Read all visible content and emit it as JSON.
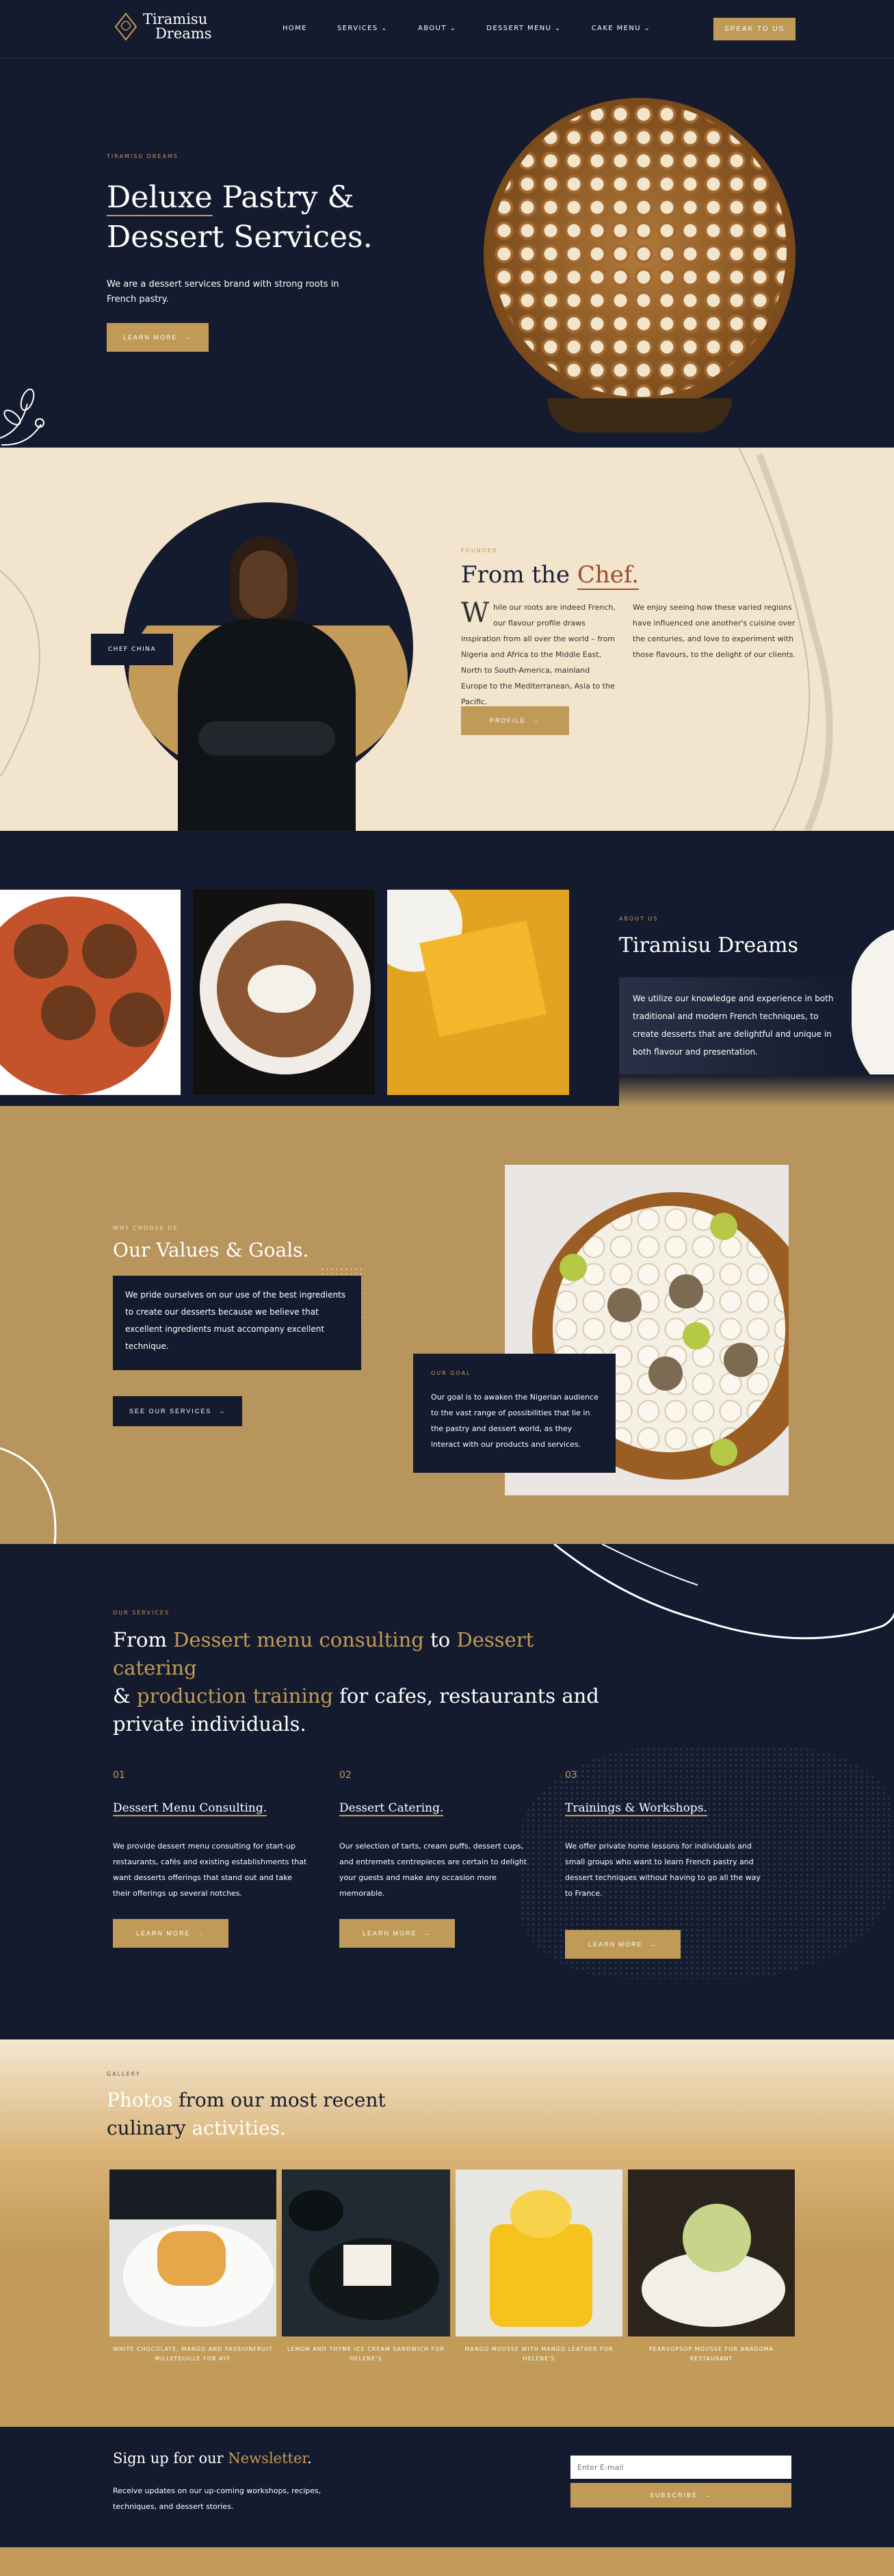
{
  "header": {
    "logo": {
      "line1": "Tiramisu",
      "line2": "Dreams"
    },
    "nav": [
      {
        "label": "HOME",
        "chevron": false
      },
      {
        "label": "SERVICES",
        "chevron": true
      },
      {
        "label": "ABOUT",
        "chevron": true
      },
      {
        "label": "DESSERT MENU",
        "chevron": true
      },
      {
        "label": "CAKE MENU",
        "chevron": true
      }
    ],
    "cta": "SPEAK TO US"
  },
  "hero": {
    "eyebrow": "TIRAMISU DREAMS",
    "title_highlight": "Deluxe",
    "title_rest": " Pastry &",
    "title_line2": "Dessert Services.",
    "text": "We are a dessert services brand with strong roots in French pastry.",
    "button": "LEARN MORE"
  },
  "chef": {
    "badge": "CHEF CHINA",
    "eyebrow": "FOUNDER",
    "title_plain": "From the ",
    "title_highlight": "Chef.",
    "drop_cap": "W",
    "col1": "hile our roots are indeed French, our flavour profile draws inspiration from all over the world – from Nigeria and Africa to the Middle East, North to South-America, mainland Europe to the Mediterranean, Asia to the Pacific.",
    "col2": "We enjoy seeing how these varied regions have influenced one another's cuisine over the centuries, and love to experiment with those flavours, to the delight of our clients.",
    "button": "PROFILE"
  },
  "about": {
    "eyebrow": "ABOUT US",
    "title": "Tiramisu Dreams",
    "text": "We utilize our knowledge and experience in both traditional and modern French techniques, to create desserts that are delightful and unique in both flavour and presentation."
  },
  "values": {
    "eyebrow": "WHY CHOOSE US",
    "title": "Our Values & Goals.",
    "text": "We pride ourselves on our use of the best ingredients to create our desserts because we believe that excellent ingredients must accompany excellent technique.",
    "button": "SEE OUR SERVICES",
    "goal_eyebrow": "OUR GOAL",
    "goal_text": "Our goal is to awaken the Nigerian audience to the vast range of possibilities that lie in the pastry and dessert world, as they interact with our products and services."
  },
  "services": {
    "eyebrow": "OUR SERVICES",
    "h_a": "From ",
    "h_b": "Dessert menu consulting",
    "h_c": " to ",
    "h_d": "Dessert catering",
    "h_e": "& ",
    "h_f": "production training",
    "h_g": " for cafes, restaurants and",
    "h_h": "private individuals.",
    "items": [
      {
        "num": "01",
        "title": "Dessert Menu Consulting.",
        "text": "We provide dessert menu consulting for start-up restaurants, cafés and existing establishments that want desserts offerings that stand out and take their offerings up several notches.",
        "button": "LEARN MORE"
      },
      {
        "num": "02",
        "title": "Dessert Catering.",
        "text": "Our selection of tarts, cream puffs, dessert cups, and entremets centrepieces are certain to delight your guests and make any occasion more memorable.",
        "button": "LEARN MORE"
      },
      {
        "num": "03",
        "title": "Trainings & Workshops.",
        "text": "We offer private home lessons for individuals and small groups who want to learn French pastry and dessert techniques without having to go all the way to France.",
        "button": "LEARN MORE"
      }
    ]
  },
  "gallery": {
    "eyebrow": "GALLERY",
    "t_a": "Photos",
    "t_b": " from our most recent",
    "t_c": "culinary ",
    "t_d": "activities.",
    "captions": [
      "WHITE CHOCOLATE, MANGO AND PASSIONFRUIT MILLEFEUILLE FOR AYF",
      "LEMON AND THYME ICE CREAM SANDWICH FOR HELENE'S",
      "MANGO MOUSSE WITH MANGO LEATHER FOR HELENE'S",
      "PEARSOPSOP MOUSSE FOR ANAGOMA RESTAURANT"
    ]
  },
  "newsletter": {
    "t_a": "Sign up for our ",
    "t_b": "Newsletter",
    "t_c": ".",
    "text": "Receive updates on our up-coming workshops, recipes, techniques, and dessert stories.",
    "placeholder": "Enter E-mail",
    "button": "SUBSCRIBE"
  }
}
